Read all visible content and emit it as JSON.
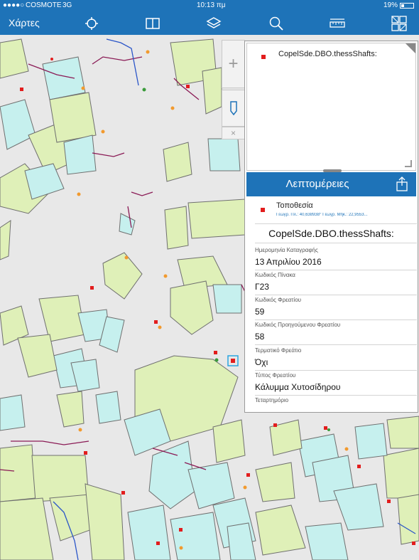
{
  "status_bar": {
    "carrier": "COSMOTE",
    "network": "3G",
    "time": "10:13 πμ",
    "battery": "19%"
  },
  "nav_bar": {
    "back_label": "Χάρτες",
    "icons": [
      "locate-icon",
      "bookmarks-icon",
      "layers-icon",
      "search-icon",
      "measure-icon",
      "basemap-gallery-icon"
    ]
  },
  "map_tools": {
    "zoom_in": "+",
    "close": "×"
  },
  "popup": {
    "title": "CopelSde.DBO.thessShafts:"
  },
  "details": {
    "header": "Λεπτομέρειες",
    "location_label": "Τοποθεσία",
    "location_coords": "Γεωγρ. Πλ.: 40,638938° Γεωγρ. Μήκ.: 22,9553...",
    "layer_title": "CopelSde.DBO.thessShafts:",
    "fields": [
      {
        "key": "Ημερομηνία Καταγραφής",
        "value": "13 Απριλίου 2016"
      },
      {
        "key": "Κωδικός Πίνακα",
        "value": "Γ23"
      },
      {
        "key": "Κωδικός Φρεατίου",
        "value": "59"
      },
      {
        "key": "Κωδικός Προηγούμενου Φρεατίου",
        "value": "58"
      },
      {
        "key": "Τερματικό Φρεάτιο",
        "value": "Όχι"
      },
      {
        "key": "Τύπος Φρεατίου",
        "value": "Κάλυμμα Χυτοσίδηρου"
      },
      {
        "key": "Τεταρτημόριο",
        "value": ""
      }
    ]
  },
  "colors": {
    "nav_blue": "#1e73b8",
    "building_green": "#dff0b8",
    "building_cyan": "#c6f0ee",
    "parcel_line": "#8a1a55",
    "shaft_red": "#e21d1d",
    "point_orange": "#f29a2e"
  }
}
